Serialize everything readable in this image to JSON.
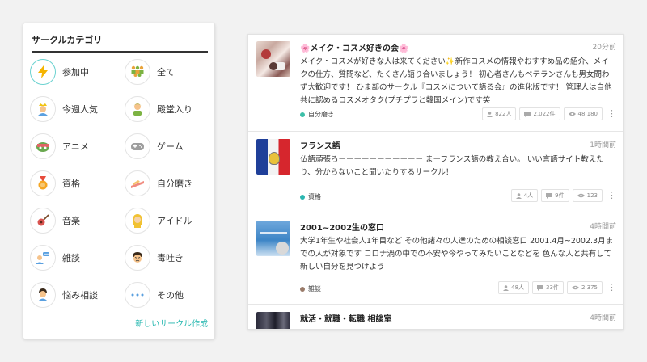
{
  "sidebar": {
    "title": "サークルカテゴリ",
    "categories": [
      {
        "label": "参加中",
        "icon": "lightning-icon"
      },
      {
        "label": "全て",
        "icon": "people-group-icon"
      },
      {
        "label": "今週人気",
        "icon": "popular-person-icon"
      },
      {
        "label": "殿堂入り",
        "icon": "hall-of-fame-icon"
      },
      {
        "label": "アニメ",
        "icon": "anime-icon"
      },
      {
        "label": "ゲーム",
        "icon": "game-controller-icon"
      },
      {
        "label": "資格",
        "icon": "medal-icon"
      },
      {
        "label": "自分磨き",
        "icon": "self-improvement-icon"
      },
      {
        "label": "音楽",
        "icon": "guitar-icon"
      },
      {
        "label": "アイドル",
        "icon": "idol-icon"
      },
      {
        "label": "雑談",
        "icon": "chat-people-icon"
      },
      {
        "label": "毒吐き",
        "icon": "grumpy-face-icon"
      },
      {
        "label": "悩み相談",
        "icon": "worried-person-icon"
      },
      {
        "label": "その他",
        "icon": "more-dots-icon"
      }
    ],
    "new_circle_label": "新しいサークル作成"
  },
  "circles": [
    {
      "title": "🌸メイク・コスメ好きの会🌸",
      "time": "20分前",
      "description": "メイク・コスメが好きな人は来てください✨新作コスメの情報やおすすめ品の紹介、メイクの仕方、質問など、たくさん語り合いましょう！ 初心者さんもベテランさんも男女問わず大歓迎です！ ひま部のサークル『コスメについて語る会』の進化版です！ 管理人は自他共に認めるコスメオタク(プチプラと韓国メイン)です笑",
      "tag": "自分磨き",
      "tag_color": "#3cbfa8",
      "members": "822人",
      "posts": "2,022件",
      "views": "48,180"
    },
    {
      "title": "フランス語",
      "time": "1時間前",
      "description": "仏語頑張ろーーーーーーーーーーー まーフランス語の教え合い。 いい言語サイト教えたり、分からないこと聞いたりするサークル！",
      "tag": "資格",
      "tag_color": "#2bb6b0",
      "members": "4人",
      "posts": "9件",
      "views": "123"
    },
    {
      "title": "2001~2002生の窓口",
      "time": "4時間前",
      "description": "大学1年生や社会人1年目など その他諸々の人達のための相談窓口 2001.4月~2002.3月までの人が対象です コロナ渦の中での不安や今やってみたいことなどを 色んな人と共有して新しい自分を見つけよう",
      "tag": "雑談",
      "tag_color": "#9a7b6a",
      "members": "48人",
      "posts": "33件",
      "views": "2,375"
    },
    {
      "title": "就活・就職・転職 相談室",
      "time": "4時間前"
    }
  ],
  "colors": {
    "accent": "#1fb5ad",
    "background": "#f2f2f2"
  }
}
